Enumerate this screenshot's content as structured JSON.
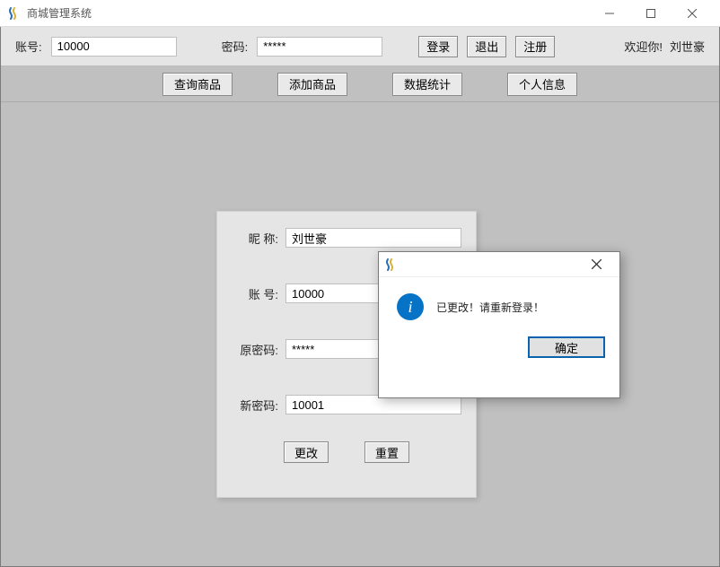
{
  "window": {
    "title": "商城管理系统"
  },
  "topbar": {
    "account_label": "账号:",
    "account_value": "10000",
    "password_label": "密码:",
    "password_value": "*****",
    "login_label": "登录",
    "logout_label": "退出",
    "register_label": "注册",
    "welcome_prefix": "欢迎你!",
    "welcome_user": "刘世豪"
  },
  "navbar": {
    "query_goods": "查询商品",
    "add_goods": "添加商品",
    "stats": "数据统计",
    "profile": "个人信息"
  },
  "form": {
    "nickname_label": "昵 称:",
    "nickname_value": "刘世豪",
    "account_label": "账 号:",
    "account_value": "10000",
    "old_pwd_label": "原密码:",
    "old_pwd_value": "*****",
    "new_pwd_label": "新密码:",
    "new_pwd_value": "10001",
    "change_label": "更改",
    "reset_label": "重置"
  },
  "dialog": {
    "message": "已更改！请重新登录！",
    "ok_label": "确定"
  }
}
